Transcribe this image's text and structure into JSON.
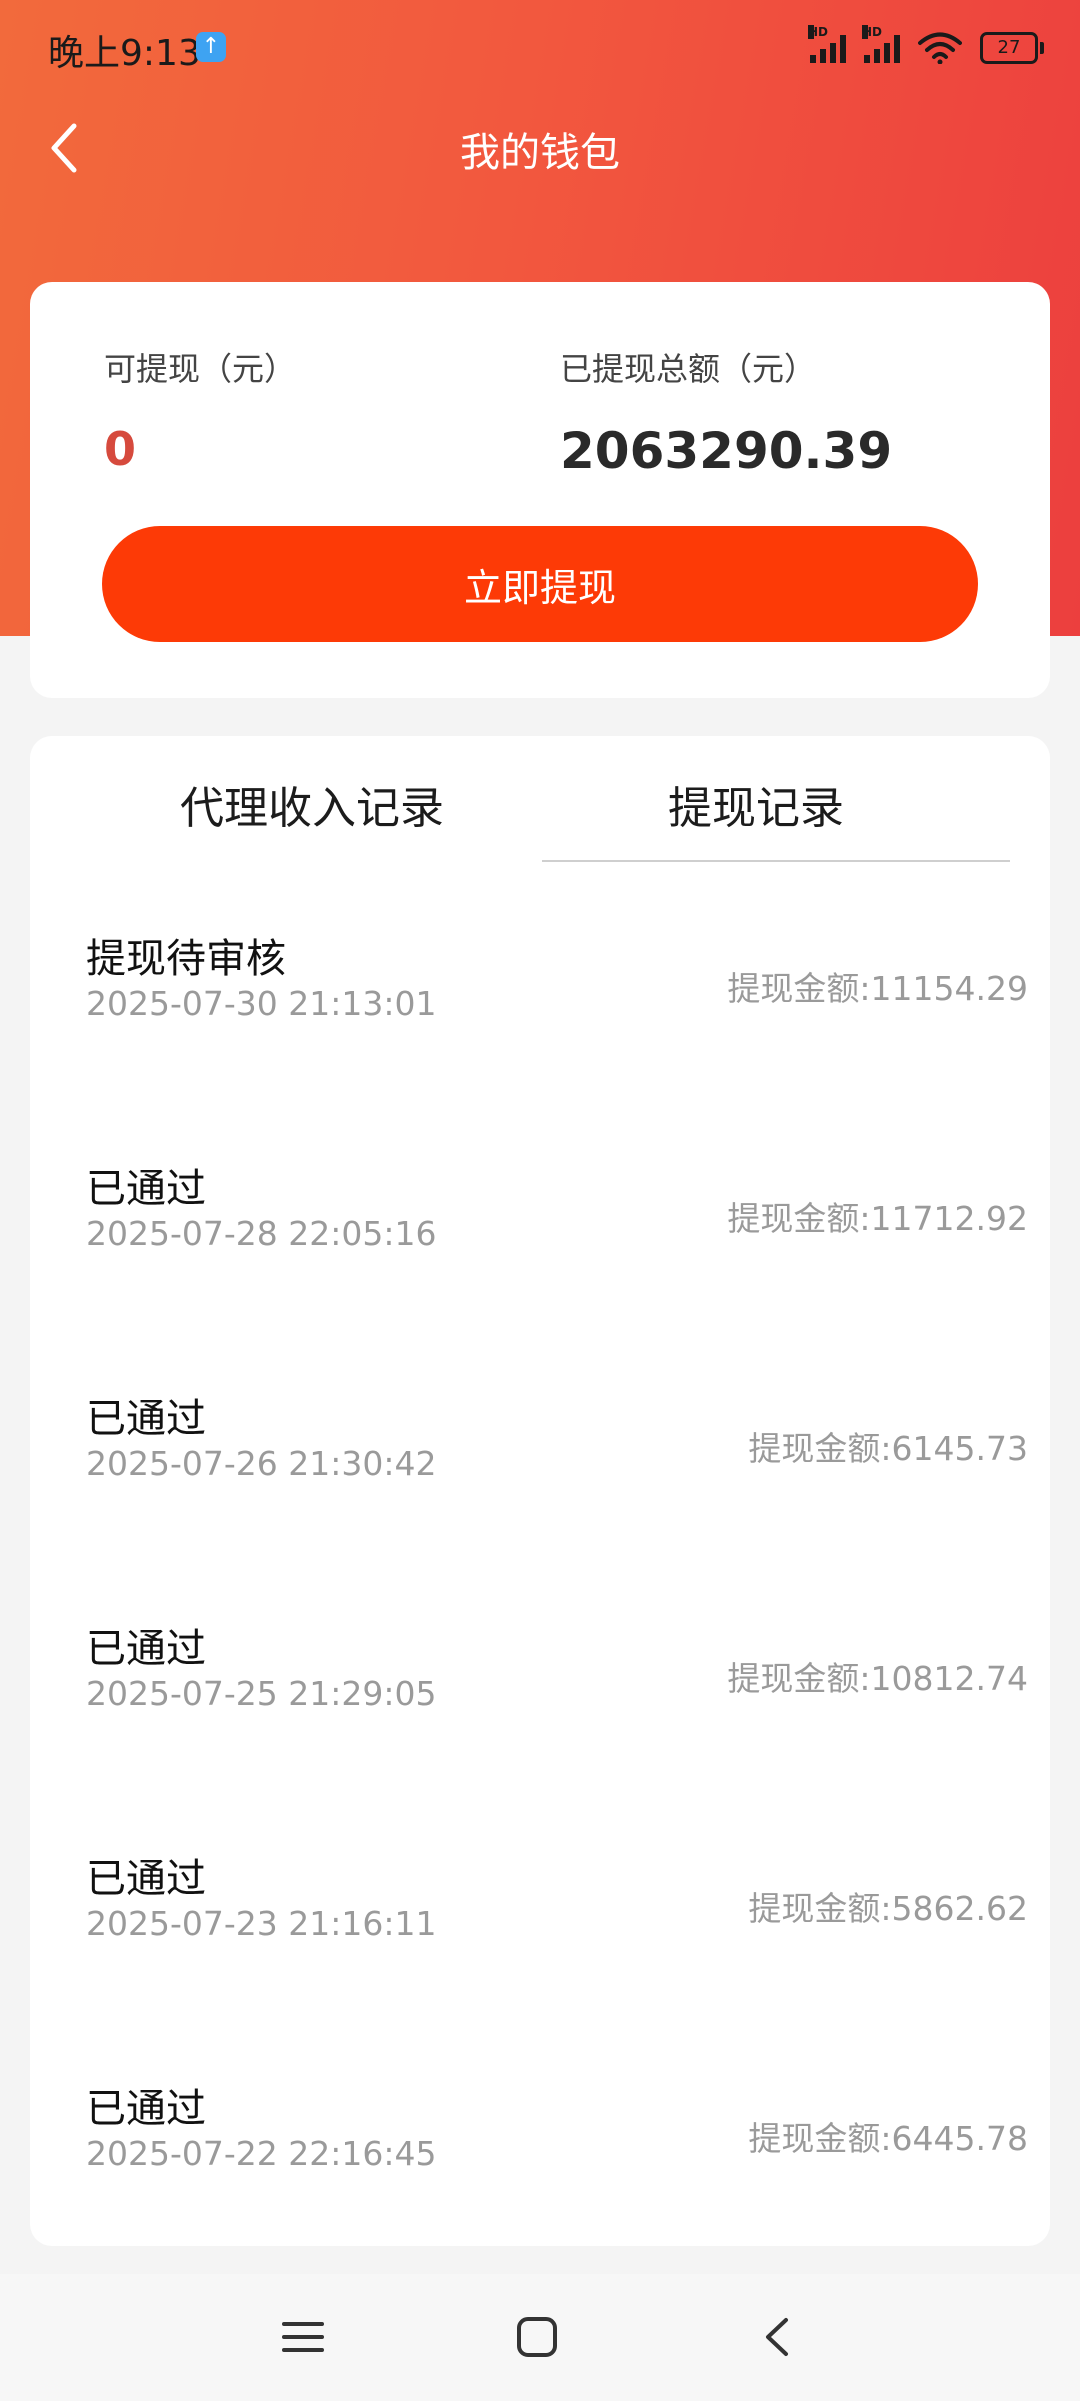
{
  "status_bar": {
    "time": "晚上9:13",
    "notify_icon": "upload-arrow-icon",
    "network_labels": [
      "HD",
      "HD"
    ],
    "battery": "27"
  },
  "nav": {
    "title": "我的钱包",
    "back_icon": "chevron-left-icon"
  },
  "wallet": {
    "available_label": "可提现（元）",
    "available_value": "0",
    "total_label": "已提现总额（元）",
    "total_value": "2063290.39",
    "withdraw_button": "立即提现"
  },
  "tabs": [
    {
      "label": "代理收入记录",
      "active": false
    },
    {
      "label": "提现记录",
      "active": true
    }
  ],
  "records": [
    {
      "status": "提现待审核",
      "time": "2025-07-30 21:13:01",
      "amount": "提现金额:11154.29"
    },
    {
      "status": "已通过",
      "time": "2025-07-28 22:05:16",
      "amount": "提现金额:11712.92"
    },
    {
      "status": "已通过",
      "time": "2025-07-26 21:30:42",
      "amount": "提现金额:6145.73"
    },
    {
      "status": "已通过",
      "time": "2025-07-25 21:29:05",
      "amount": "提现金额:10812.74"
    },
    {
      "status": "已通过",
      "time": "2025-07-23 21:16:11",
      "amount": "提现金额:5862.62"
    },
    {
      "status": "已通过",
      "time": "2025-07-22 22:16:45",
      "amount": "提现金额:6445.78"
    }
  ],
  "colors": {
    "header_gradient_start": "#f26a3c",
    "header_gradient_end": "#ec3f3e",
    "button": "#fd3a06",
    "available_value": "#d64a3d"
  }
}
